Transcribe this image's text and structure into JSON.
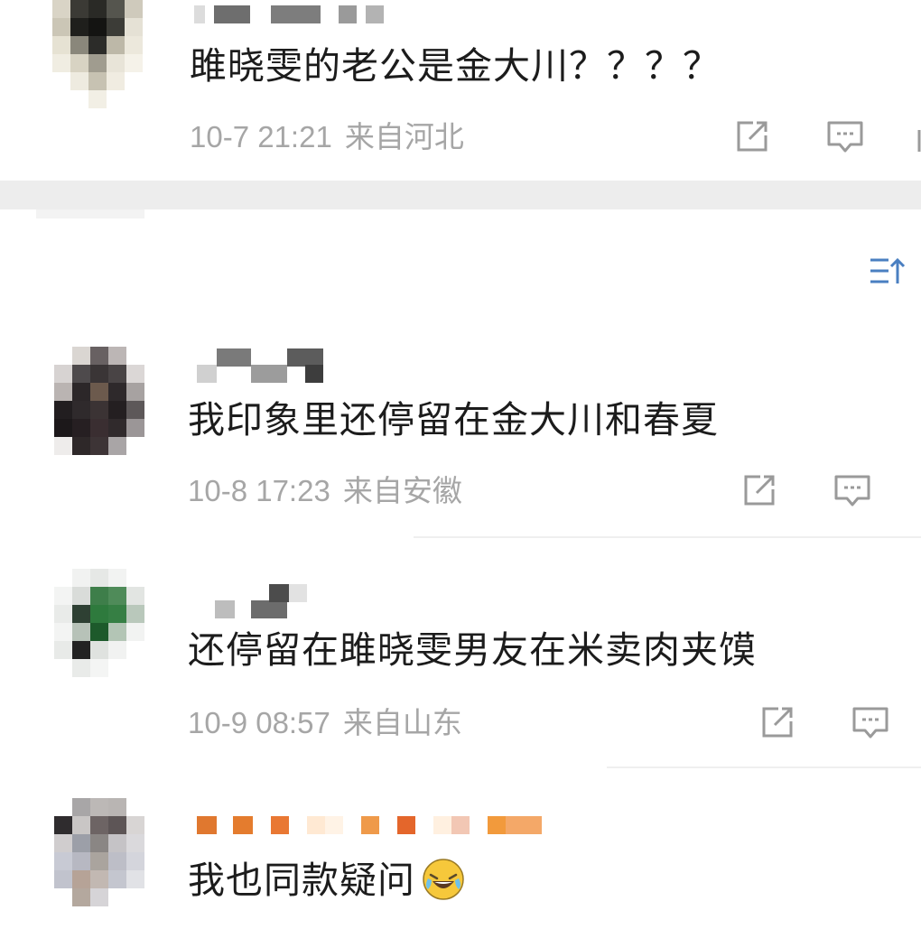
{
  "comments": [
    {
      "text": "雎晓雯的老公是金大川？？？？",
      "date": "10-7 21:21",
      "location": "来自河北"
    },
    {
      "text": "我印象里还停留在金大川和春夏",
      "date": "10-8 17:23",
      "location": "来自安徽"
    },
    {
      "text": "还停留在雎晓雯男友在米卖肉夹馍",
      "date": "10-9 08:57",
      "location": "来自山东"
    },
    {
      "text": "我也同款疑问",
      "emoji": "laughing-crying-emoji"
    }
  ],
  "icons": {
    "share": "share-icon",
    "reply": "comment-icon",
    "sort": "sort-icon"
  },
  "colors": {
    "meta_text": "#a6a6a6",
    "icon_stroke": "#9a9a9a",
    "sort_icon": "#4a7fc1",
    "divider": "#efefef"
  }
}
